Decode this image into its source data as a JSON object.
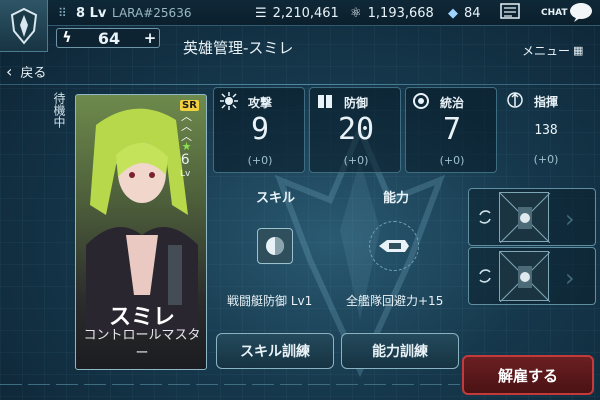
{
  "topbar": {
    "level": "8 Lv",
    "player_id": "LARA#25636",
    "resource1": "2,210,461",
    "resource2": "1,193,668",
    "crystals": "84",
    "chat_label": "CHAT"
  },
  "energy": {
    "value": "64",
    "plus": "+"
  },
  "header": {
    "title": "英雄管理-スミレ",
    "menu_label": "メニュー",
    "back_label": "戻る"
  },
  "hero": {
    "status": "待機中",
    "rarity": "SR",
    "level": "6",
    "level_unit": "Lv",
    "name": "スミレ",
    "class": "コントロールマスター"
  },
  "stats": [
    {
      "label": "攻撃",
      "value": "9",
      "bonus": "(+0)",
      "icon": "attack-burst-icon"
    },
    {
      "label": "防御",
      "value": "20",
      "bonus": "(+0)",
      "icon": "defense-book-icon"
    },
    {
      "label": "統治",
      "value": "7",
      "bonus": "(+0)",
      "icon": "command-gear-icon"
    },
    {
      "label": "指揮",
      "value": "138",
      "bonus": "(+0)",
      "icon": "leadership-icon"
    }
  ],
  "skill": {
    "header": "スキル",
    "name": "戦闘艇防御 Lv1",
    "train_label": "スキル訓練"
  },
  "ability": {
    "header": "能力",
    "name": "全艦隊回避力+15",
    "train_label": "能力訓練"
  },
  "dismiss_label": "解雇する",
  "colors": {
    "accent": "#8ab3c2",
    "danger": "#c33a3a",
    "background": "#16384c"
  }
}
